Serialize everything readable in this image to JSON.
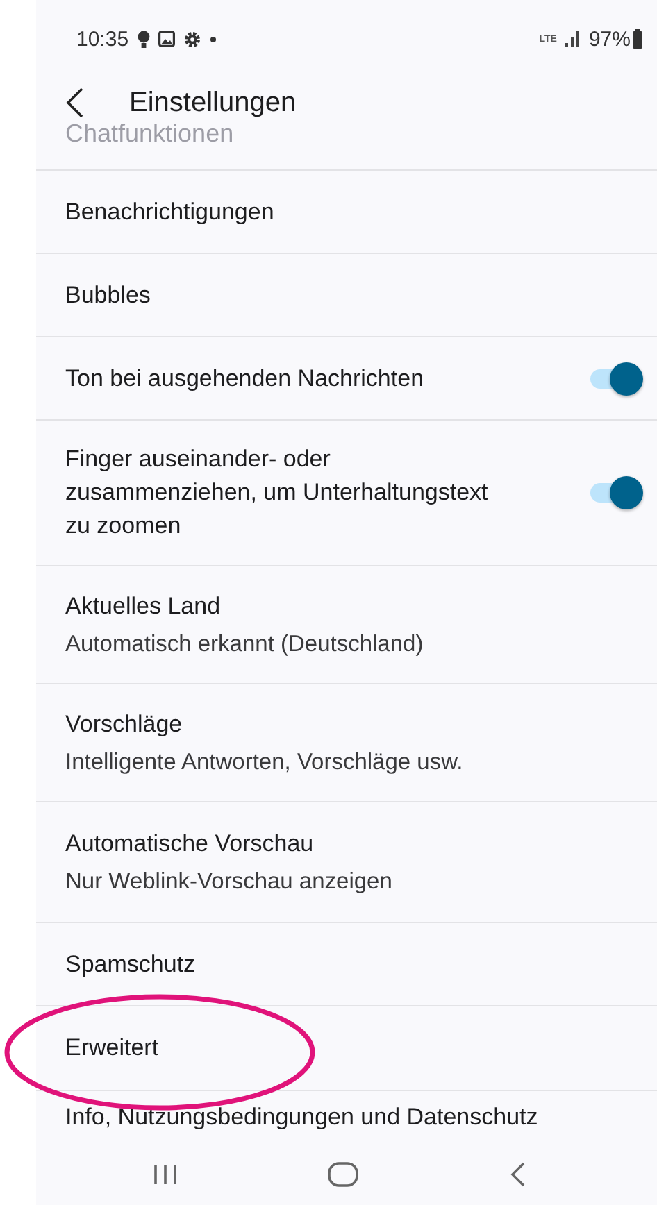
{
  "status_bar": {
    "time": "10:35",
    "network": "LTE",
    "battery": "97%"
  },
  "header": {
    "title": "Einstellungen",
    "subtitle": "Chatfunktionen"
  },
  "settings": [
    {
      "kind": "plain",
      "title": "Benachrichtigungen"
    },
    {
      "kind": "plain",
      "title": "Bubbles"
    },
    {
      "kind": "toggle",
      "title": "Ton bei ausgehenden Nachrichten",
      "on": true
    },
    {
      "kind": "toggle",
      "title": "Finger auseinander- oder zusammenziehen, um Unterhaltungstext zu zoomen",
      "on": true
    },
    {
      "kind": "plain",
      "title": "Aktuelles Land",
      "summary": "Automatisch erkannt (Deutschland)"
    },
    {
      "kind": "plain",
      "title": "Vorschläge",
      "summary": "Intelligente Antworten, Vorschläge usw."
    },
    {
      "kind": "plain",
      "title": "Automatische Vorschau",
      "summary": "Nur Weblink-Vorschau anzeigen"
    },
    {
      "kind": "plain",
      "title": "Spamschutz"
    },
    {
      "kind": "plain",
      "title": "Erweitert",
      "highlighted": true
    },
    {
      "kind": "plain",
      "title": "Info, Nutzungsbedingungen und Datenschutz"
    }
  ]
}
